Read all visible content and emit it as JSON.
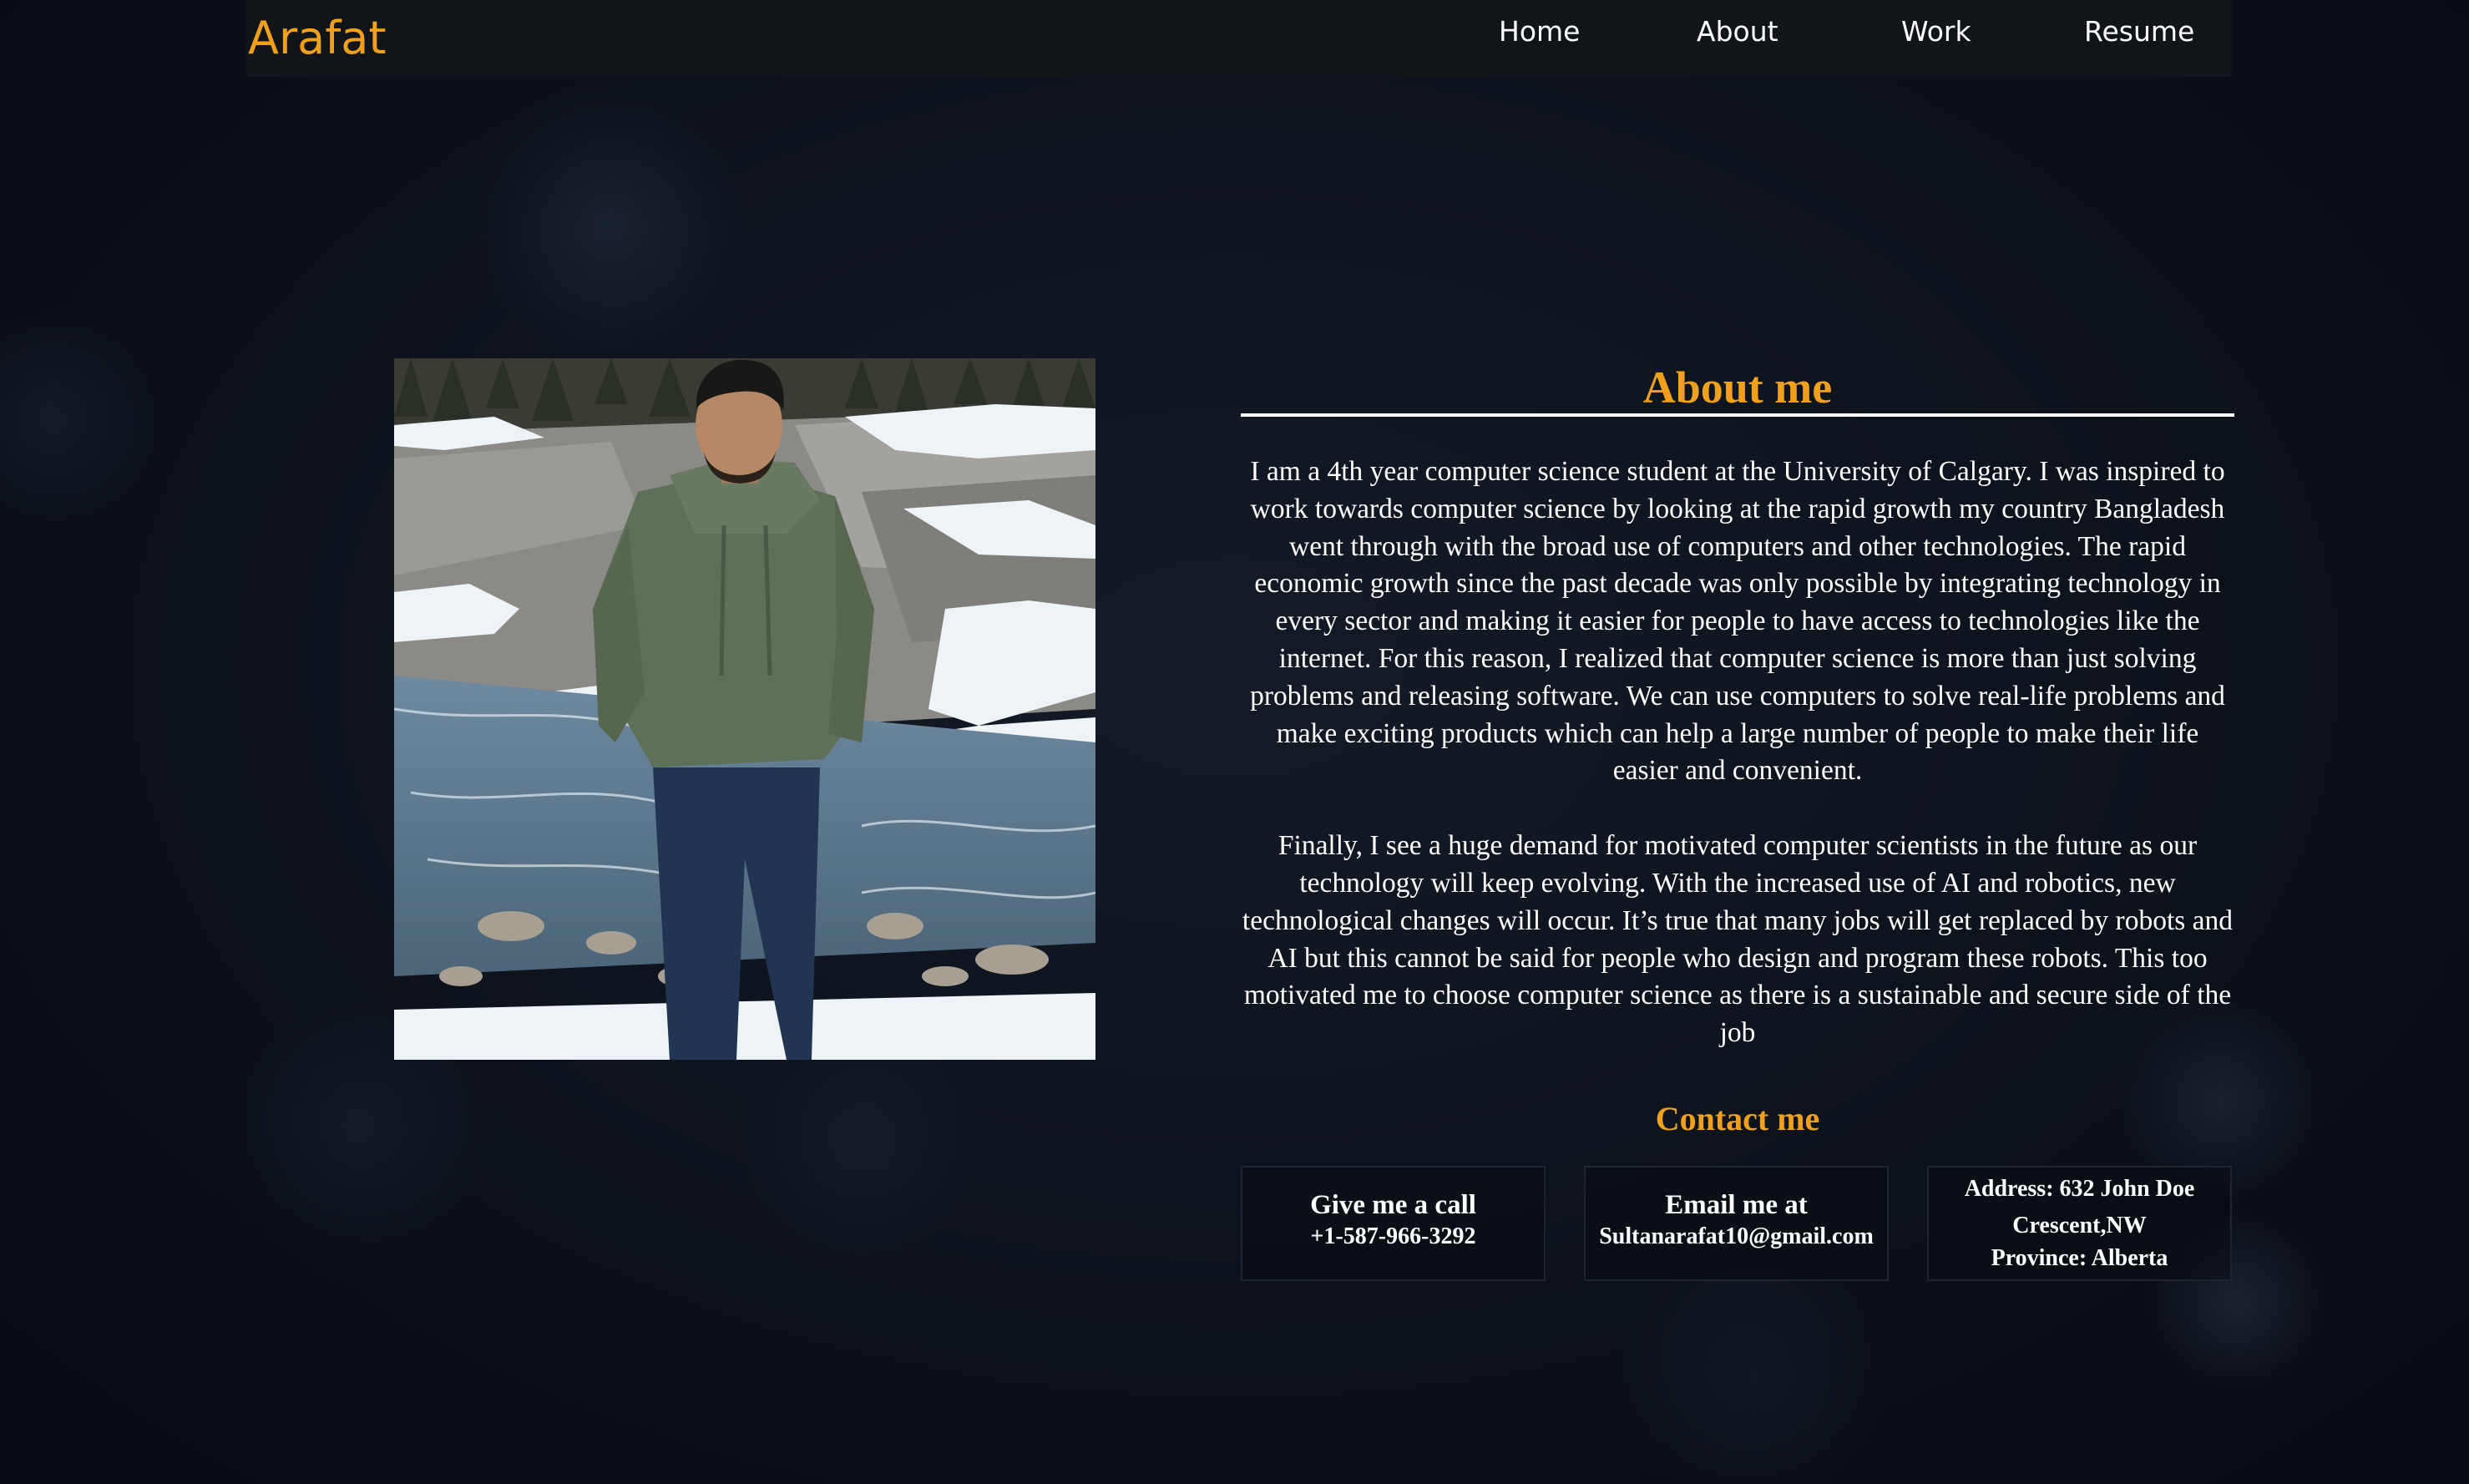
{
  "nav": {
    "brand": "Arafat",
    "links": [
      "Home",
      "About",
      "Work",
      "Resume"
    ]
  },
  "about": {
    "title": "About me",
    "paragraph1": "I am a 4th year computer science student at the University of Calgary. I was inspired to work towards computer science by looking at the rapid growth my country Bangladesh went through with the broad use of computers and other technologies. The rapid economic growth since the past decade was only possible by integrating technology in every sector and making it easier for people to have access to technologies like the internet. For this reason, I realized that computer science is more than just solving problems and releasing software. We can use computers to solve real-life problems and make exciting products which can help a large number of people to make their life easier and convenient.",
    "paragraph2": "Finally, I see a huge demand for motivated computer scientists in the future as our technology will keep evolving. With the increased use of AI and robotics, new technological changes will occur. It’s true that many jobs will get replaced by robots and AI but this cannot be said for people who design and program these robots. This too motivated me to choose computer science as there is a sustainable and secure side of the job"
  },
  "contact": {
    "title": "Contact me",
    "call_heading": "Give me a call",
    "phone": "+1-587-966-3292",
    "email_heading": "Email me at",
    "email": "Sultanarafat10@gmail.com",
    "address_line1": "Address: 632 John Doe Crescent,NW",
    "address_line2": "Province: Alberta"
  },
  "colors": {
    "accent": "#f0a01a",
    "background": "#0c1119",
    "navbar": "#111419"
  }
}
